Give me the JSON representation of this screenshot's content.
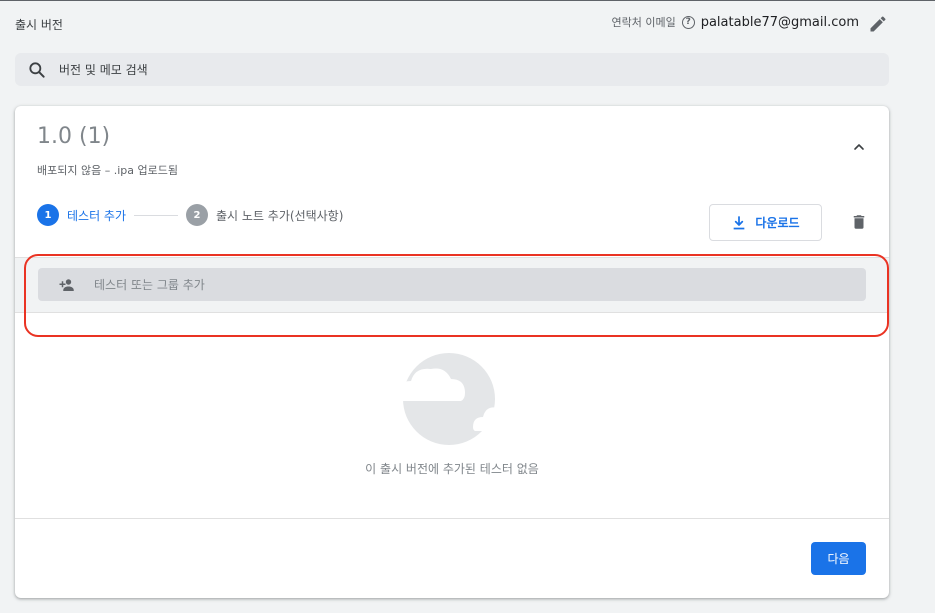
{
  "header": {
    "title": "출시 버전",
    "contact_label": "연락처 이메일",
    "help_glyph": "?",
    "contact_email": "palatable77@gmail.com"
  },
  "search": {
    "text": "버전 및 메모 검색"
  },
  "release": {
    "title": "1.0 (1)",
    "subtitle": "배포되지 않음 – .ipa 업로드됨"
  },
  "stepper": {
    "steps": [
      {
        "number": "1",
        "label": "테스터 추가"
      },
      {
        "number": "2",
        "label": "출시 노트 추가(선택사항)"
      }
    ]
  },
  "actions": {
    "download_label": "다운로드",
    "next_label": "다음"
  },
  "testers": {
    "input_placeholder": "테스터 또는 그룹 추가",
    "empty_message": "이 출시 버전에 추가된 테스터 없음"
  },
  "colors": {
    "accent": "#1a73e8",
    "highlight": "#ea3323"
  }
}
